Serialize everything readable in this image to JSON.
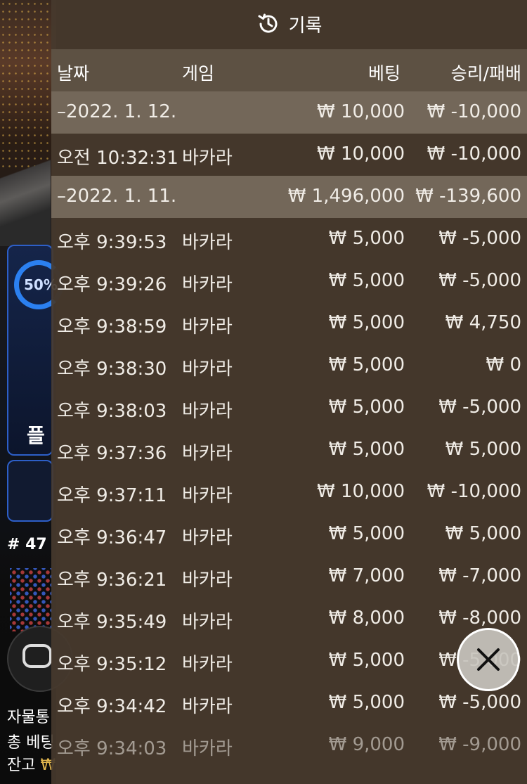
{
  "background": {
    "player_percent": "50%",
    "player_label": "플",
    "round_label": "# 47",
    "autofill_label": "자물통",
    "total_bet_label": "총 베팅",
    "balance_label": "잔고",
    "balance_currency": "₩"
  },
  "history": {
    "title": "기록",
    "columns": {
      "date": "날짜",
      "game": "게임",
      "bet": "베팅",
      "result": "승리/패배"
    },
    "rows": [
      {
        "type": "date",
        "date": "–2022. 1. 12.",
        "game": "",
        "bet": "₩ 10,000",
        "result": "₩ -10,000"
      },
      {
        "type": "entry",
        "date": "오전 10:32:31",
        "game": "바카라",
        "bet": "₩ 10,000",
        "result": "₩ -10,000"
      },
      {
        "type": "date",
        "date": "–2022. 1. 11.",
        "game": "",
        "bet": "₩ 1,496,000",
        "result": "₩ -139,600"
      },
      {
        "type": "entry",
        "date": "오후 9:39:53",
        "game": "바카라",
        "bet": "₩ 5,000",
        "result": "₩ -5,000"
      },
      {
        "type": "entry",
        "date": "오후 9:39:26",
        "game": "바카라",
        "bet": "₩ 5,000",
        "result": "₩ -5,000"
      },
      {
        "type": "entry",
        "date": "오후 9:38:59",
        "game": "바카라",
        "bet": "₩ 5,000",
        "result": "₩ 4,750"
      },
      {
        "type": "entry",
        "date": "오후 9:38:30",
        "game": "바카라",
        "bet": "₩ 5,000",
        "result": "₩ 0"
      },
      {
        "type": "entry",
        "date": "오후 9:38:03",
        "game": "바카라",
        "bet": "₩ 5,000",
        "result": "₩ -5,000"
      },
      {
        "type": "entry",
        "date": "오후 9:37:36",
        "game": "바카라",
        "bet": "₩ 5,000",
        "result": "₩ 5,000"
      },
      {
        "type": "entry",
        "date": "오후 9:37:11",
        "game": "바카라",
        "bet": "₩ 10,000",
        "result": "₩ -10,000"
      },
      {
        "type": "entry",
        "date": "오후 9:36:47",
        "game": "바카라",
        "bet": "₩ 5,000",
        "result": "₩ 5,000"
      },
      {
        "type": "entry",
        "date": "오후 9:36:21",
        "game": "바카라",
        "bet": "₩ 7,000",
        "result": "₩ -7,000"
      },
      {
        "type": "entry",
        "date": "오후 9:35:49",
        "game": "바카라",
        "bet": "₩ 8,000",
        "result": "₩ -8,000"
      },
      {
        "type": "entry",
        "date": "오후 9:35:12",
        "game": "바카라",
        "bet": "₩ 5,000",
        "result": "₩ -5,000"
      },
      {
        "type": "entry",
        "date": "오후 9:34:42",
        "game": "바카라",
        "bet": "₩ 5,000",
        "result": "₩ -5,000"
      },
      {
        "type": "entry",
        "date": "오후 9:34:03",
        "game": "바카라",
        "bet": "₩ 9,000",
        "result": "₩ -9,000"
      }
    ]
  },
  "icons": {
    "header": "history-icon",
    "close": "close-icon"
  }
}
